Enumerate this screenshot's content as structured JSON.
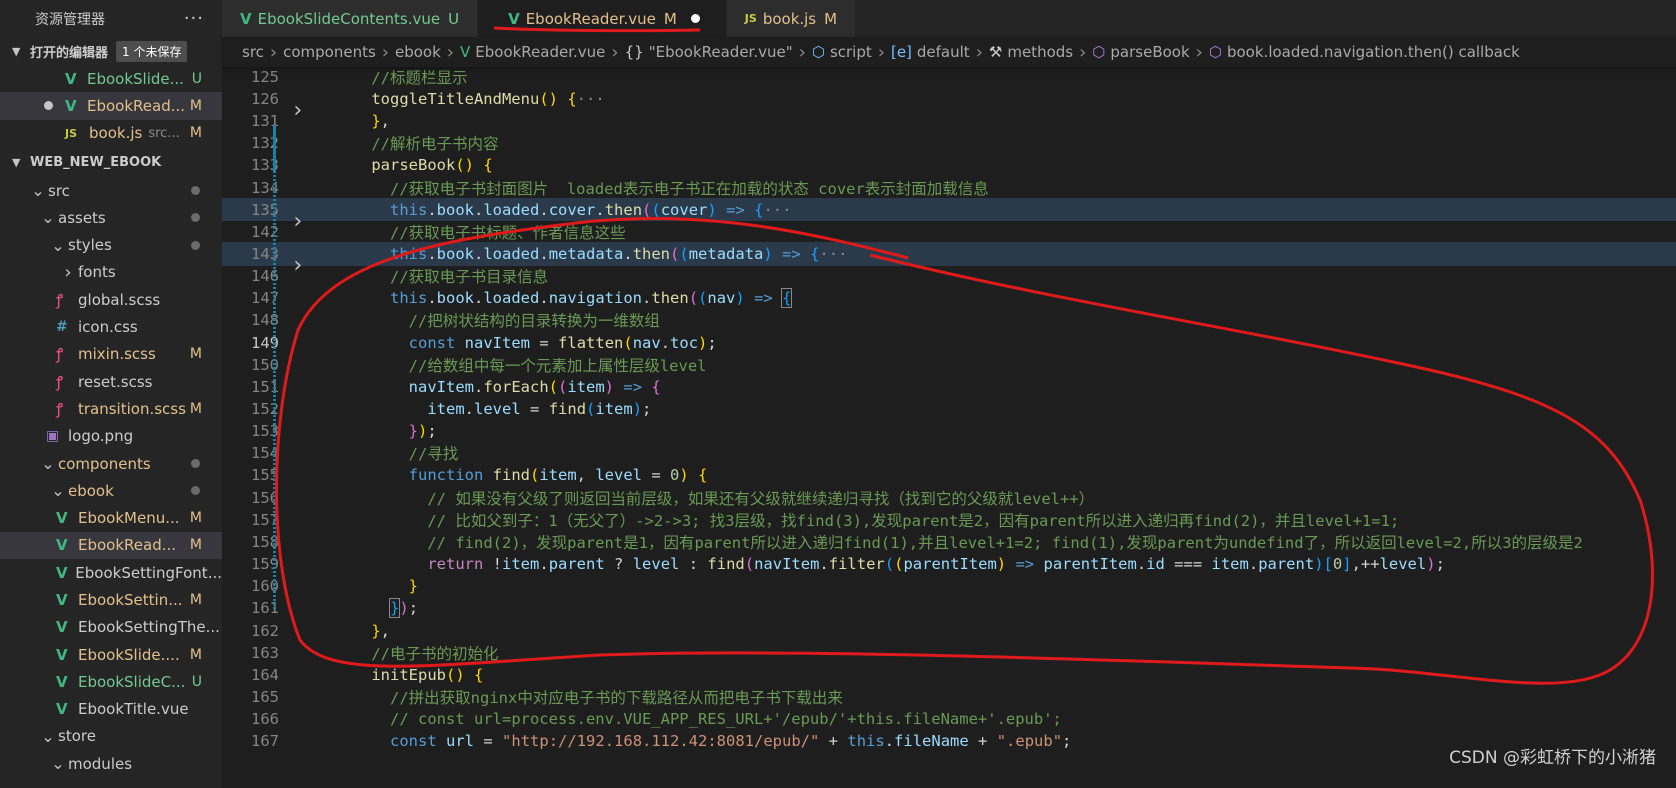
{
  "sidebar": {
    "title": "资源管理器",
    "more": "···",
    "open_editors": {
      "label": "打开的编辑器",
      "unsaved_badge": "1 个未保存",
      "items": [
        {
          "name": "EbookSlide...",
          "status": "U"
        },
        {
          "name": "EbookRead...",
          "status": "M"
        },
        {
          "name": "book.js",
          "desc": "src...",
          "status": "M"
        }
      ]
    },
    "workspace": {
      "label": "WEB_NEW_EBOOK",
      "tree": [
        {
          "name": "src"
        },
        {
          "name": "assets"
        },
        {
          "name": "styles"
        },
        {
          "name": "fonts"
        },
        {
          "name": "global.scss"
        },
        {
          "name": "icon.css"
        },
        {
          "name": "mixin.scss",
          "status": "M"
        },
        {
          "name": "reset.scss"
        },
        {
          "name": "transition.scss",
          "status": "M"
        },
        {
          "name": "logo.png"
        },
        {
          "name": "components"
        },
        {
          "name": "ebook"
        },
        {
          "name": "EbookMenu...",
          "status": "M"
        },
        {
          "name": "EbookRead...",
          "status": "M"
        },
        {
          "name": "EbookSettingFont..."
        },
        {
          "name": "EbookSettin...",
          "status": "M"
        },
        {
          "name": "EbookSettingThe..."
        },
        {
          "name": "EbookSlide....",
          "status": "M"
        },
        {
          "name": "EbookSlideC...",
          "status": "U"
        },
        {
          "name": "EbookTitle.vue"
        },
        {
          "name": "store"
        },
        {
          "name": "modules"
        }
      ]
    }
  },
  "tabs": [
    {
      "label": "EbookSlideContents.vue",
      "status": "U",
      "icon": "vue-icon"
    },
    {
      "label": "EbookReader.vue",
      "status": "M",
      "icon": "vue-icon",
      "active": true
    },
    {
      "label": "book.js",
      "status": "M",
      "icon": "js-icon"
    }
  ],
  "breadcrumb": [
    "src",
    "components",
    "ebook",
    "EbookReader.vue",
    "\"EbookReader.vue\"",
    "script",
    "default",
    "methods",
    "parseBook",
    "book.loaded.navigation.then() callback"
  ],
  "editor": {
    "lines": [
      {
        "n": "125",
        "html": "    <span class='c-cm'>//标题栏显示</span>"
      },
      {
        "n": "126",
        "fold": true,
        "html": "    <span class='c-fn'>toggleTitleAndMenu</span><span class='c-p1'>()</span> <span class='c-p1'>{</span><span class='c-ell'>···</span>"
      },
      {
        "n": "131",
        "html": "    <span class='c-p1'>}</span><span class='c-w'>,</span>"
      },
      {
        "n": "132",
        "html": "    <span class='c-cm'>//解析电子书内容</span>"
      },
      {
        "n": "133",
        "html": "    <span class='c-fn'>parseBook</span><span class='c-p1'>()</span> <span class='c-p1'>{</span>"
      },
      {
        "n": "134",
        "html": "      <span class='c-cm'>//获取电子书封面图片  loaded表示电子书正在加载的状态 cover表示封面加载信息</span>"
      },
      {
        "n": "135",
        "fold": true,
        "hl": true,
        "html": "      <span class='c-kw'>this</span><span class='c-w'>.</span><span class='c-var'>book</span><span class='c-w'>.</span><span class='c-var'>loaded</span><span class='c-w'>.</span><span class='c-var'>cover</span><span class='c-w'>.</span><span class='c-fn'>then</span><span class='c-p2'>(</span><span class='c-p3'>(</span><span class='c-var'>cover</span><span class='c-p3'>)</span> <span class='c-kw'>=&gt;</span> <span class='c-p3'>{</span><span class='c-ell'>···</span>"
      },
      {
        "n": "142",
        "html": "      <span class='c-cm'>//获取电子书标题、作者信息这些</span>"
      },
      {
        "n": "143",
        "fold": true,
        "hl": true,
        "html": "      <span class='c-kw'>this</span><span class='c-w'>.</span><span class='c-var'>book</span><span class='c-w'>.</span><span class='c-var'>loaded</span><span class='c-w'>.</span><span class='c-var'>metadata</span><span class='c-w'>.</span><span class='c-fn'>then</span><span class='c-p2'>(</span><span class='c-p3'>(</span><span class='c-var'>metadata</span><span class='c-p3'>)</span> <span class='c-kw'>=&gt;</span> <span class='c-p3'>{</span><span class='c-ell'>···</span>"
      },
      {
        "n": "146",
        "html": "      <span class='c-cm'>//获取电子书目录信息</span>"
      },
      {
        "n": "147",
        "html": "      <span class='c-kw'>this</span><span class='c-w'>.</span><span class='c-var'>book</span><span class='c-w'>.</span><span class='c-var'>loaded</span><span class='c-w'>.</span><span class='c-var'>navigation</span><span class='c-w'>.</span><span class='c-fn'>then</span><span class='c-p2'>(</span><span class='c-p3'>(</span><span class='c-var'>nav</span><span class='c-p3'>)</span> <span class='c-kw'>=&gt;</span> <span class='c-p3 lhbox'>{</span>"
      },
      {
        "n": "148",
        "html": "        <span class='c-cm'>//把树状结构的目录转换为一维数组</span>"
      },
      {
        "n": "149",
        "cur": true,
        "html": "        <span class='c-kw'>const</span> <span class='c-var'>navItem</span> <span class='c-w'>=</span> <span class='c-fn'>flatten</span><span class='c-p1'>(</span><span class='c-var'>nav</span><span class='c-w'>.</span><span class='c-var'>toc</span><span class='c-p1'>)</span><span class='c-w'>;</span>"
      },
      {
        "n": "150",
        "html": "        <span class='c-cm'>//给数组中每一个元素加上属性层级level</span>"
      },
      {
        "n": "151",
        "html": "        <span class='c-var'>navItem</span><span class='c-w'>.</span><span class='c-fn'>forEach</span><span class='c-p1'>(</span><span class='c-p2'>(</span><span class='c-var'>item</span><span class='c-p2'>)</span> <span class='c-kw'>=&gt;</span> <span class='c-p2'>{</span>"
      },
      {
        "n": "152",
        "html": "          <span class='c-var'>item</span><span class='c-w'>.</span><span class='c-var'>level</span> <span class='c-w'>=</span> <span class='c-fn'>find</span><span class='c-p3'>(</span><span class='c-var'>item</span><span class='c-p3'>)</span><span class='c-w'>;</span>"
      },
      {
        "n": "153",
        "html": "        <span class='c-p2'>}</span><span class='c-p1'>)</span><span class='c-w'>;</span>"
      },
      {
        "n": "154",
        "html": "        <span class='c-cm'>//寻找</span>"
      },
      {
        "n": "155",
        "html": "        <span class='c-kw'>function</span> <span class='c-fn'>find</span><span class='c-p1'>(</span><span class='c-var'>item</span><span class='c-w'>,</span> <span class='c-var'>level</span> <span class='c-w'>=</span> <span class='c-num'>0</span><span class='c-p1'>)</span> <span class='c-p1'>{</span>"
      },
      {
        "n": "156",
        "html": "          <span class='c-cm'>// 如果没有父级了则返回当前层级，如果还有父级就继续递归寻找（找到它的父级就level++）</span>"
      },
      {
        "n": "157",
        "html": "          <span class='c-cm'>// 比如父到子：1（无父了）-&gt;2-&gt;3; 找3层级，找find(3),发现parent是2，因有parent所以进入递归再find(2)，并且level+1=1;</span>"
      },
      {
        "n": "158",
        "html": "          <span class='c-cm'>// find(2)，发现parent是1，因有parent所以进入递归find(1),并且level+1=2; find(1),发现parent为undefind了，所以返回level=2,所以3的层级是2</span>"
      },
      {
        "n": "159",
        "html": "          <span class='c-ctl'>return</span> <span class='c-w'>!</span><span class='c-var'>item</span><span class='c-w'>.</span><span class='c-var'>parent</span> <span class='c-w'>?</span> <span class='c-var'>level</span> <span class='c-w'>:</span> <span class='c-fn'>find</span><span class='c-p2'>(</span><span class='c-var'>navItem</span><span class='c-w'>.</span><span class='c-fn'>filter</span><span class='c-p3'>(</span><span class='c-p1'>(</span><span class='c-var'>parentItem</span><span class='c-p1'>)</span> <span class='c-kw'>=&gt;</span> <span class='c-var'>parentItem</span><span class='c-w'>.</span><span class='c-var'>id</span> <span class='c-w'>===</span> <span class='c-var'>item</span><span class='c-w'>.</span><span class='c-var'>parent</span><span class='c-p3'>)</span><span class='c-p3'>[</span><span class='c-num'>0</span><span class='c-p3'>]</span><span class='c-w'>,++</span><span class='c-var'>level</span><span class='c-p2'>)</span><span class='c-w'>;</span>"
      },
      {
        "n": "160",
        "html": "        <span class='c-p1'>}</span>"
      },
      {
        "n": "161",
        "html": "      <span class='c-p3 lhbox'>}</span><span class='c-p2'>)</span><span class='c-w'>;</span>"
      },
      {
        "n": "162",
        "html": "    <span class='c-p1'>}</span><span class='c-w'>,</span>"
      },
      {
        "n": "163",
        "html": "    <span class='c-cm'>//电子书的初始化</span>"
      },
      {
        "n": "164",
        "html": "    <span class='c-fn'>initEpub</span><span class='c-p1'>()</span> <span class='c-p1'>{</span>"
      },
      {
        "n": "165",
        "html": "      <span class='c-cm'>//拼出获取nginx中对应电子书的下载路径从而把电子书下载出来</span>"
      },
      {
        "n": "166",
        "html": "      <span class='c-cm'>// const url=process.env.VUE_APP_RES_URL+'/epub/'+this.fileName+'.epub';</span>"
      },
      {
        "n": "167",
        "html": "      <span class='c-kw'>const</span> <span class='c-var'>url</span> <span class='c-w'>=</span> <span class='c-str'>\"http://192.168.112.42:8081/epub/\"</span> <span class='c-w'>+</span> <span class='c-kw'>this</span><span class='c-w'>.</span><span class='c-var'>fileName</span> <span class='c-w'>+</span> <span class='c-str'>\".epub\"</span><span class='c-w'>;</span>"
      }
    ]
  },
  "watermark": "CSDN @彩虹桥下的小淅猪",
  "colors": {
    "annotation": "#e0191b",
    "vue": "#41b883",
    "modified": "#e2c08d",
    "untracked": "#73c991"
  }
}
